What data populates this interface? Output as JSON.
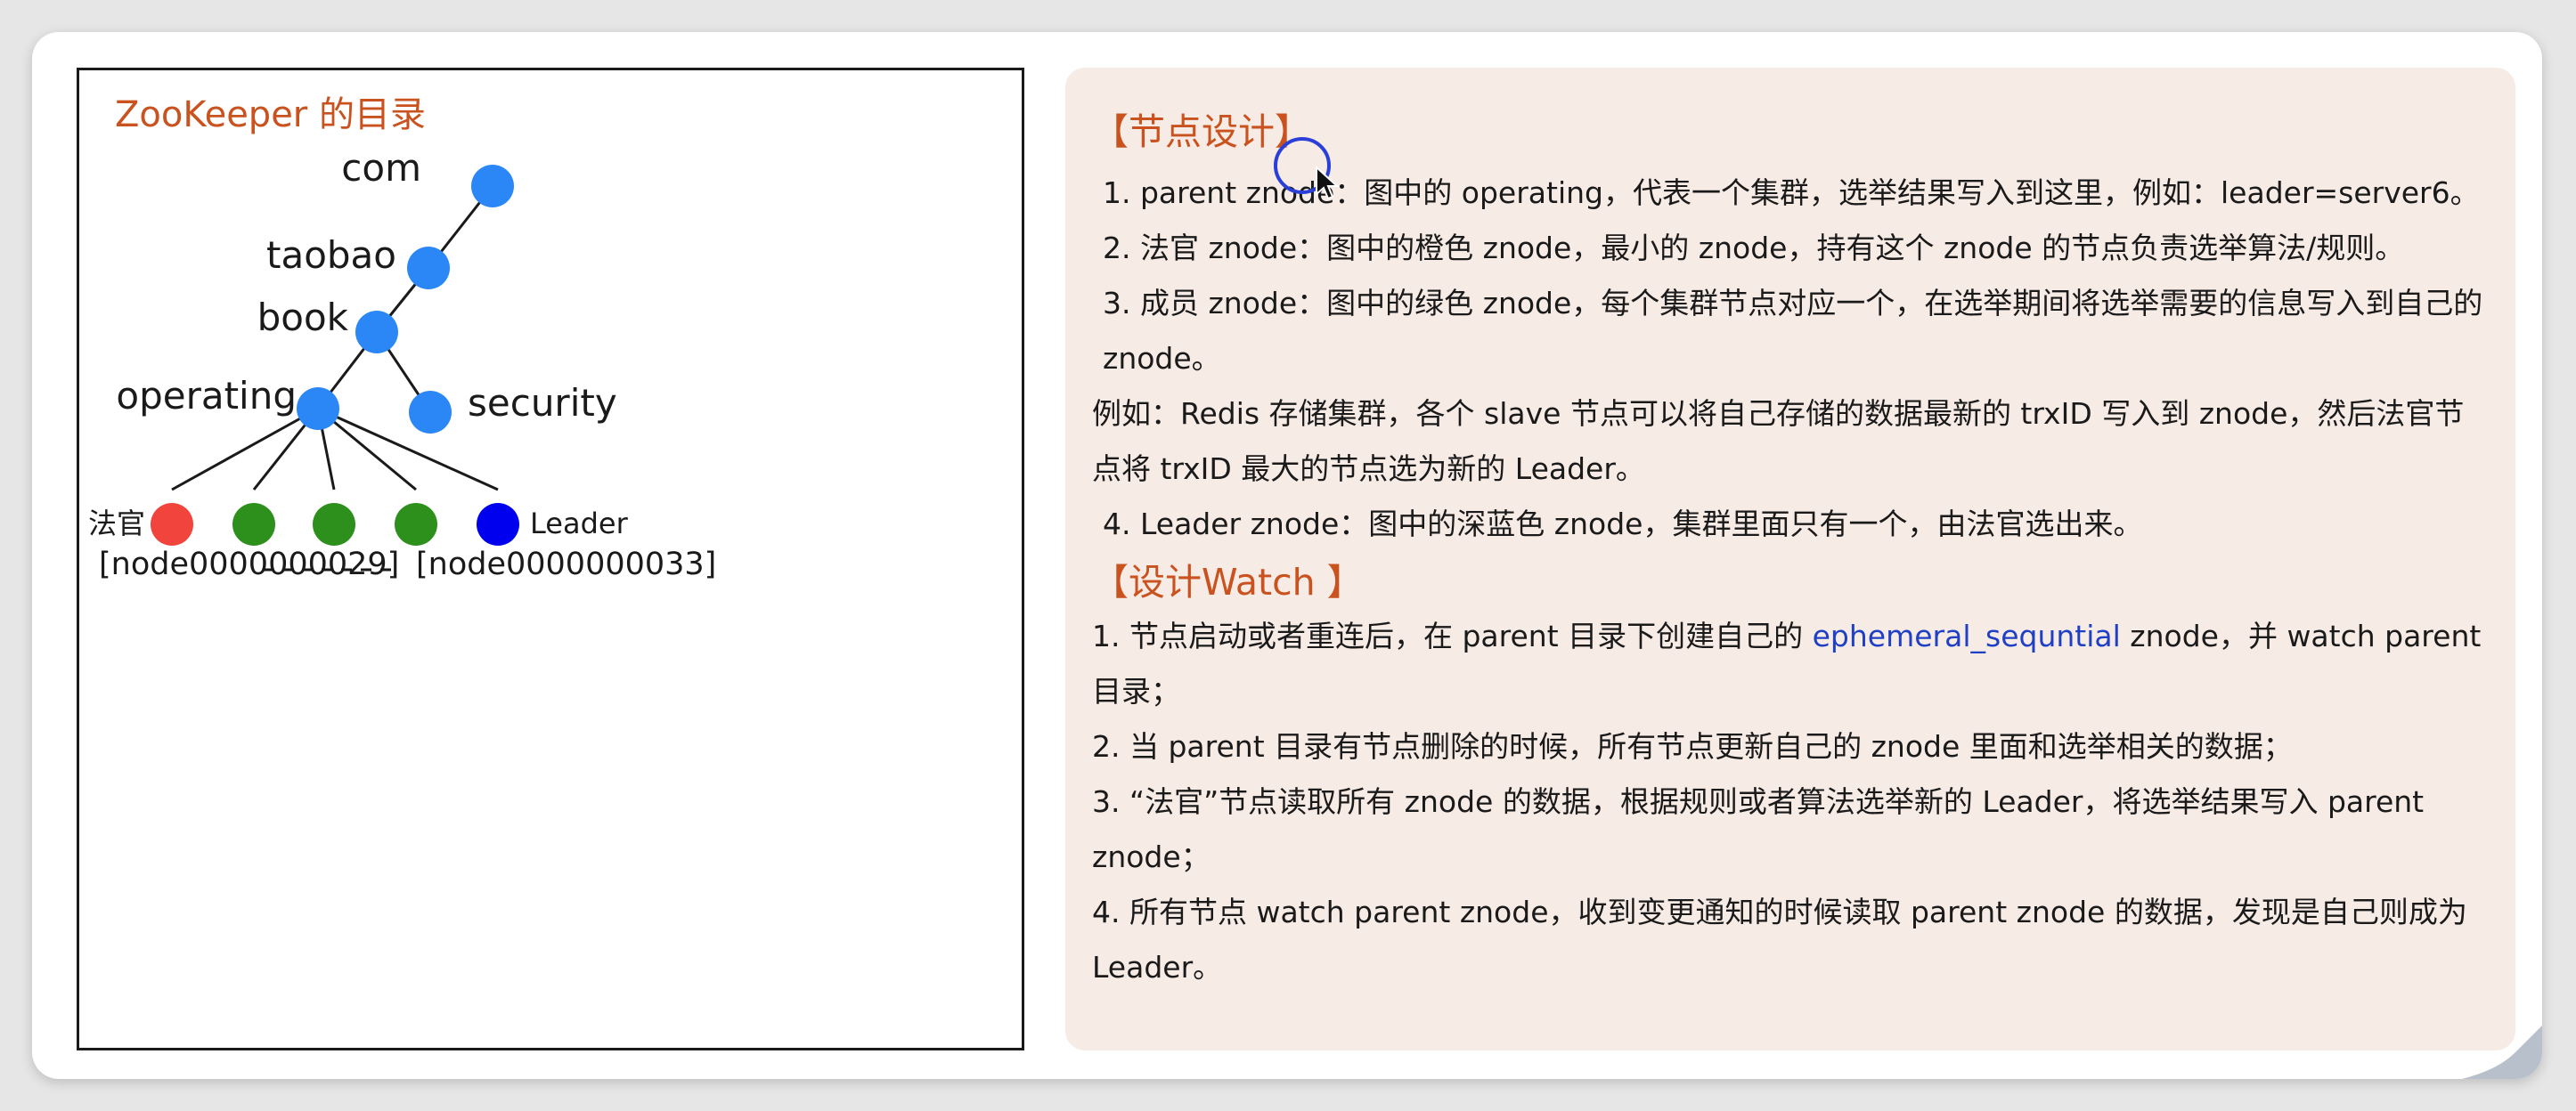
{
  "diagram": {
    "title": "ZooKeeper 的目录",
    "nodes": {
      "com": "com",
      "taobao": "taobao",
      "book": "book",
      "operating": "operating",
      "security": "security"
    },
    "leaf_left_label": "法官",
    "leaf_right_label": "Leader",
    "range_start": "[node0000000029]",
    "range_end": "[node0000000033]",
    "colors": {
      "node_blue": "#2b87f5",
      "judge_red": "#f0443c",
      "member_green": "#2d8f1c",
      "leader_dark_blue": "#0000ee"
    }
  },
  "notes": {
    "design_heading": "【节点设计】",
    "design_items": [
      "1. parent znode：图中的 operating，代表一个集群，选举结果写入到这里，例如：leader=server6。",
      "2. 法官 znode：图中的橙色 znode，最小的 znode，持有这个 znode 的节点负责选举算法/规则。",
      "3. 成员 znode：图中的绿色 znode，每个集群节点对应一个，在选举期间将选举需要的信息写入到自己的 znode。"
    ],
    "example_text": "例如：Redis 存储集群，各个 slave 节点可以将自己存储的数据最新的 trxID 写入到 znode，然后法官节点将 trxID 最大的节点选为新的 Leader。",
    "design_item_4": "4. Leader znode：图中的深蓝色 znode，集群里面只有一个，由法官选出来。",
    "watch_heading": "【设计Watch 】",
    "watch_item_1_before": "1. 节点启动或者重连后，在 parent 目录下创建自己的 ",
    "watch_item_1_term": "ephemeral_sequntial",
    "watch_item_1_after": " znode，并 watch parent 目录；",
    "watch_items": [
      "2. 当 parent 目录有节点删除的时候，所有节点更新自己的 znode 里面和选举相关的数据；",
      "3. “法官”节点读取所有 znode 的数据，根据规则或者算法选举新的 Leader，将选举结果写入 parent znode；",
      "4. 所有节点 watch parent znode，收到变更通知的时候读取 parent znode 的数据，发现是自己则成为 Leader。"
    ]
  }
}
